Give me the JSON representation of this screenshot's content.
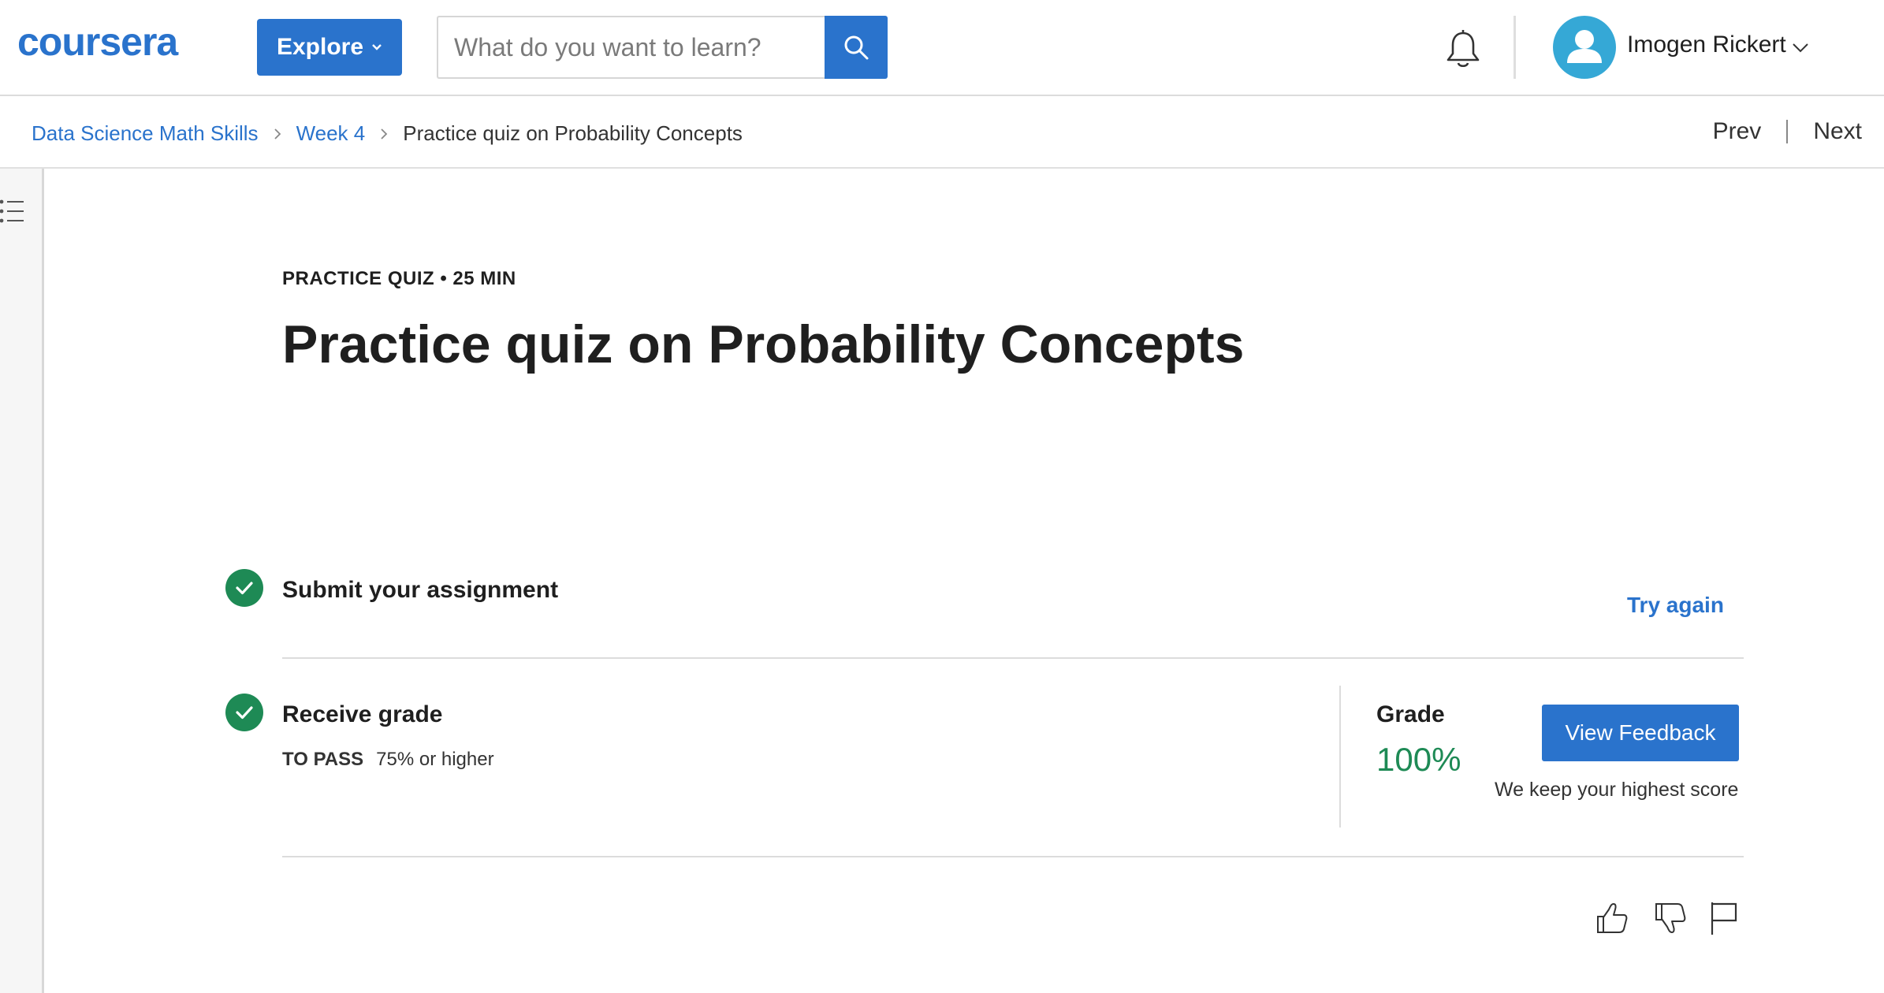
{
  "header": {
    "logo_text": "coursera",
    "explore_label": "Explore",
    "search": {
      "placeholder": "What do you want to learn?",
      "value": ""
    },
    "user_name": "Imogen Rickert"
  },
  "breadcrumb": {
    "items": [
      "Data Science Math Skills",
      "Week 4"
    ],
    "current": "Practice quiz on Probability Concepts",
    "prev_label": "Prev",
    "next_label": "Next"
  },
  "main": {
    "eyebrow": "PRACTICE QUIZ • 25 MIN",
    "title": "Practice quiz on Probability Concepts",
    "steps": [
      {
        "label": "Submit your assignment",
        "action": "Try again",
        "done": true
      },
      {
        "label": "Receive grade",
        "done": true
      }
    ],
    "to_pass": {
      "key": "TO PASS",
      "value": "75% or higher"
    },
    "grade": {
      "label": "Grade",
      "value": "100%",
      "button": "View Feedback",
      "note": "We keep your highest score"
    }
  },
  "colors": {
    "brand_blue": "#2a73cc",
    "success_green": "#1e8a55",
    "avatar_blue": "#35a8d6"
  },
  "icons": [
    "search-icon",
    "bell-icon",
    "user-avatar-icon",
    "chevron-down-icon",
    "chevron-right-icon",
    "list-icon",
    "check-icon",
    "thumbs-up-icon",
    "thumbs-down-icon",
    "flag-icon"
  ]
}
